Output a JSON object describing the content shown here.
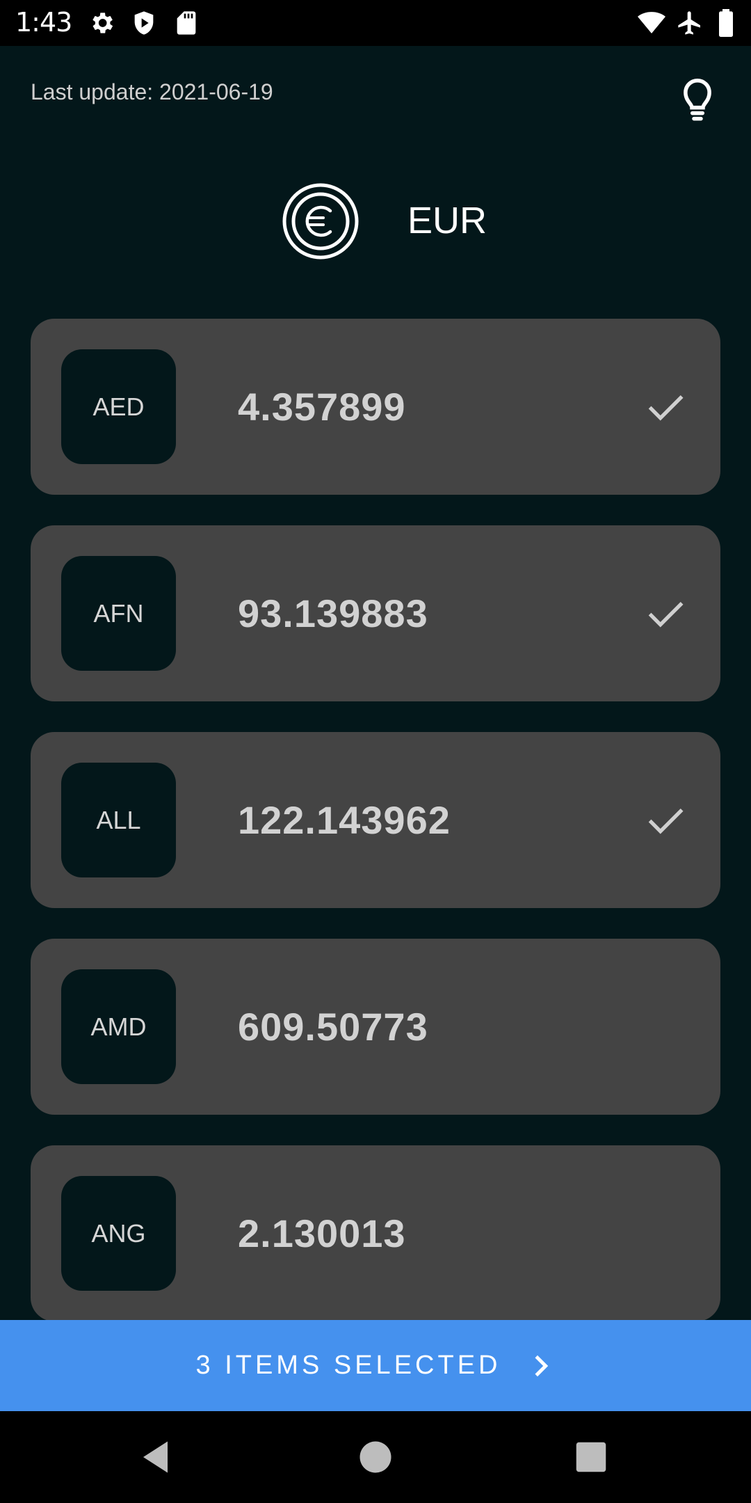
{
  "status_bar": {
    "time": "1:43",
    "left_icons": [
      "gear-icon",
      "shield-play-icon",
      "sd-card-icon"
    ],
    "right_icons": [
      "wifi-icon",
      "airplane-icon",
      "battery-icon"
    ]
  },
  "header": {
    "last_update": "Last update: 2021-06-19",
    "tip_icon": "lightbulb-icon"
  },
  "base_currency": {
    "icon": "euro-coin-icon",
    "code": "EUR"
  },
  "currencies": [
    {
      "code": "AED",
      "rate": "4.357899",
      "selected": true
    },
    {
      "code": "AFN",
      "rate": "93.139883",
      "selected": true
    },
    {
      "code": "ALL",
      "rate": "122.143962",
      "selected": true
    },
    {
      "code": "AMD",
      "rate": "609.50773",
      "selected": false
    },
    {
      "code": "ANG",
      "rate": "2.130013",
      "selected": false
    }
  ],
  "cta": {
    "label": "3 ITEMS SELECTED",
    "icon": "chevron-right-icon"
  },
  "nav_bar": {
    "buttons": [
      "back-icon",
      "home-icon",
      "recents-icon"
    ]
  },
  "colors": {
    "background": "#03171a",
    "card": "#444444",
    "accent": "#4591ee"
  }
}
